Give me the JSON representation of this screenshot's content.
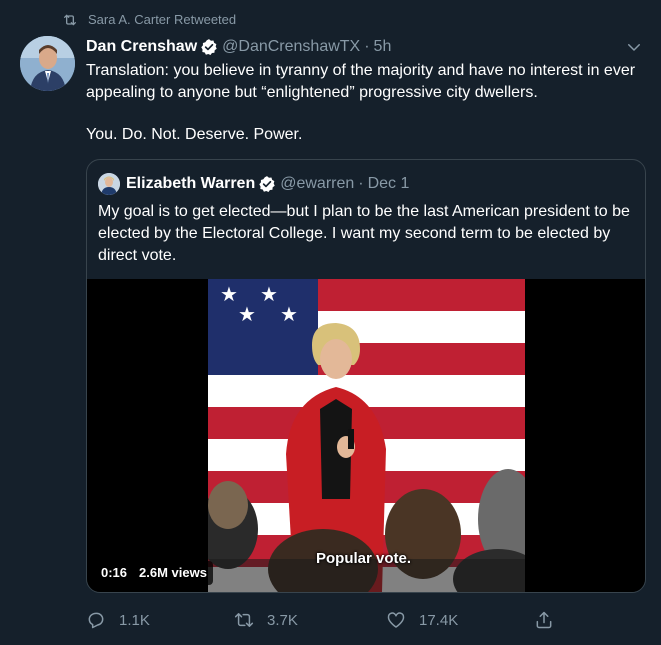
{
  "retweet_banner": {
    "text": "Sara A. Carter Retweeted",
    "icon": "retweet-icon"
  },
  "tweet": {
    "author_name": "Dan Crenshaw",
    "verified": true,
    "handle": "@DanCrenshawTX",
    "separator": "·",
    "time": "5h",
    "paragraph_1": "Translation: you believe in tyranny of the majority and have no interest in ever appealing to anyone but “enlightened” progressive city dwellers.",
    "paragraph_2": "You. Do. Not. Deserve. Power."
  },
  "quoted_tweet": {
    "author_name": "Elizabeth Warren",
    "verified": true,
    "handle": "@ewarren",
    "separator": "·",
    "time": "Dec 1",
    "text": "My goal is to get elected—but I plan to be the last American president to be elected by the Electoral College. I want my second term to be elected by direct vote.",
    "video": {
      "caption": "Popular vote.",
      "duration": "0:16",
      "views": "2.6M views"
    }
  },
  "actions": {
    "replies": "1.1K",
    "retweets": "3.7K",
    "likes": "17.4K"
  },
  "colors": {
    "background": "#15202b",
    "secondary_text": "#8899a6",
    "border": "#38444d",
    "verified_badge": "#ffffff"
  }
}
